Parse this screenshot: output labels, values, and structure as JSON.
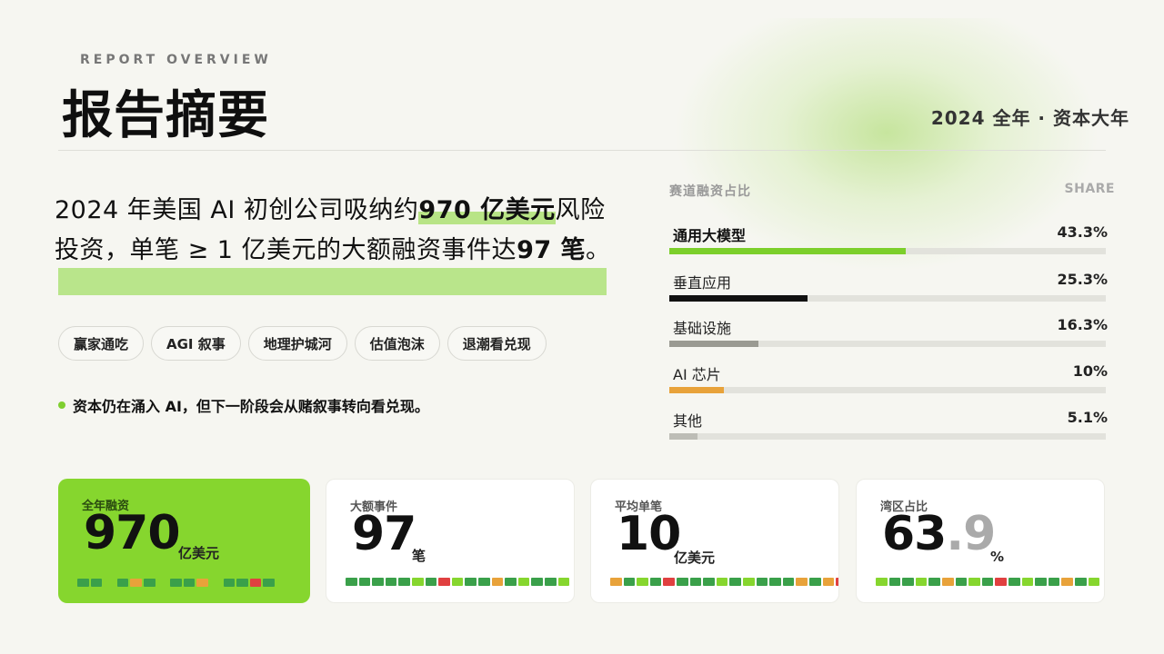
{
  "header": {
    "eyebrow": "REPORT OVERVIEW",
    "title": "报告摘要",
    "year_label": "2024 全年 · 资本大年"
  },
  "headline": {
    "part1": "2024 年美国 AI 初创公司吸纳约",
    "highlight1": "970 亿美元",
    "part2": "风险投资，单笔 ≥ 1 亿美元的大额融资事件达",
    "highlight2": "97 笔",
    "part3": "。"
  },
  "tags": [
    "赢家通吃",
    "AGI 叙事",
    "地理护城河",
    "估值泡沫",
    "退潮看兑现"
  ],
  "bullet": "资本仍在涌入 AI，但下一阶段会从赌叙事转向看兑现。",
  "share_panel": {
    "title": "赛道融资占比",
    "right_label": "SHARE",
    "rows": [
      {
        "label": "通用大模型",
        "pct_text": "43.3%",
        "value": 43.3,
        "color": "#7ccf2b"
      },
      {
        "label": "垂直应用",
        "pct_text": "25.3%",
        "value": 25.3,
        "color": "#111111"
      },
      {
        "label": "基础设施",
        "pct_text": "16.3%",
        "value": 16.3,
        "color": "#9a9a92"
      },
      {
        "label": "AI 芯片",
        "pct_text": "10%",
        "value": 10,
        "color": "#e8a23a"
      },
      {
        "label": "其他",
        "pct_text": "5.1%",
        "value": 5.1,
        "color": "#bdbdb6"
      }
    ]
  },
  "cards": [
    {
      "label": "全年融资",
      "value": "970",
      "unit": "亿美元",
      "decimal": "",
      "squares": [
        "#3aa04a",
        "#3aa04a",
        "#86d62e",
        "#3aa04a",
        "#e8a23a",
        "#3aa04a",
        "#86d62e",
        "#3aa04a",
        "#3aa04a",
        "#e8a23a",
        "#86d62e",
        "#3aa04a",
        "#3aa04a",
        "#e04040",
        "#3aa04a"
      ]
    },
    {
      "label": "大额事件",
      "value": "97",
      "unit": "笔",
      "decimal": "",
      "squares": [
        "#3aa04a",
        "#3aa04a",
        "#3aa04a",
        "#3aa04a",
        "#3aa04a",
        "#86d62e",
        "#3aa04a",
        "#e04040",
        "#86d62e",
        "#3aa04a",
        "#3aa04a",
        "#e8a23a",
        "#3aa04a",
        "#86d62e",
        "#3aa04a",
        "#3aa04a",
        "#86d62e"
      ]
    },
    {
      "label": "平均单笔",
      "value": "10",
      "unit": "亿美元",
      "decimal": "",
      "squares": [
        "#e8a23a",
        "#3aa04a",
        "#86d62e",
        "#3aa04a",
        "#e04040",
        "#3aa04a",
        "#3aa04a",
        "#3aa04a",
        "#86d62e",
        "#3aa04a",
        "#86d62e",
        "#3aa04a",
        "#3aa04a",
        "#3aa04a",
        "#e8a23a",
        "#3aa04a",
        "#e8a23a",
        "#e04040"
      ]
    },
    {
      "label": "湾区占比",
      "value": "63",
      "unit": "%",
      "decimal": ".9",
      "squares": [
        "#86d62e",
        "#3aa04a",
        "#3aa04a",
        "#86d62e",
        "#3aa04a",
        "#e8a23a",
        "#3aa04a",
        "#86d62e",
        "#3aa04a",
        "#e04040",
        "#3aa04a",
        "#86d62e",
        "#3aa04a",
        "#3aa04a",
        "#e8a23a",
        "#3aa04a",
        "#86d62e"
      ]
    }
  ]
}
